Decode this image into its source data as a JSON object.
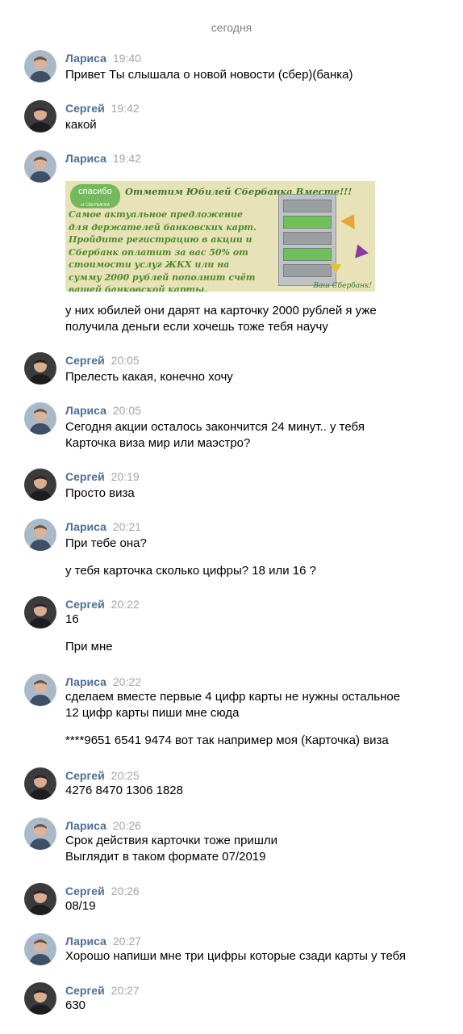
{
  "date_separator": "сегодня",
  "messages": [
    {
      "author": "Лариса",
      "time": "19:40",
      "lines": [
        "Привет Ты слышала о новой новости (сбер)(банка)"
      ]
    },
    {
      "author": "Сергей",
      "time": "19:42",
      "lines": [
        "какой"
      ]
    },
    {
      "author": "Лариса",
      "time": "19:42",
      "image": {
        "logo": "спасибо",
        "logo_sub": "от СБЕРБАНКА",
        "headline": "Отметим Юбилей Сбербанка Вместе!!!",
        "body": [
          "Самое актуальное предложение",
          "для держателей банковских карт.",
          "Пройдите регистрацию в акции и",
          "Сбербанк оплатит за вас 50% от",
          "стоимости услуг ЖКХ или на",
          "сумму 2000 рублей пополнит счёт",
          "вашей банковской карты."
        ],
        "signature": "Ваш Сбербанк!"
      },
      "lines": [
        "у них юбилей они дарят на карточку 2000 рублей я уже",
        "получила деньги если хочешь тоже тебя научу"
      ]
    },
    {
      "author": "Сергей",
      "time": "20:05",
      "lines": [
        "Прелесть какая, конечно хочу"
      ]
    },
    {
      "author": "Лариса",
      "time": "20:05",
      "lines": [
        "Сегодня акции осталось закончится 24 минут.. у тебя",
        "Карточка виза мир или маэстро?"
      ]
    },
    {
      "author": "Сергей",
      "time": "20:19",
      "lines": [
        "Просто виза"
      ]
    },
    {
      "author": "Лариса",
      "time": "20:21",
      "lines": [
        "При тебе она?",
        "у тебя карточка сколько цифры? 18 или 16 ?"
      ]
    },
    {
      "author": "Сергей",
      "time": "20:22",
      "lines": [
        "16",
        "При мне"
      ]
    },
    {
      "author": "Лариса",
      "time": "20:22",
      "lines": [
        "сделаем вместе первые 4 цифр карты не нужны остальное",
        "12 цифр карты пиши мне сюда",
        "****9651 6541 9474 вот так например моя (Карточка) виза"
      ]
    },
    {
      "author": "Сергей",
      "time": "20:25",
      "lines": [
        "4276 8470 1306 1828"
      ]
    },
    {
      "author": "Лариса",
      "time": "20:26",
      "lines": [
        "Срок действия карточки тоже пришли",
        "Выглядит в таком формате 07/2019"
      ]
    },
    {
      "author": "Сергей",
      "time": "20:26",
      "lines": [
        "08/19"
      ]
    },
    {
      "author": "Лариса",
      "time": "20:27",
      "lines": [
        "Хорошо напиши мне три цифры которые сзади карты у тебя"
      ]
    },
    {
      "author": "Сергей",
      "time": "20:27",
      "lines": [
        "630"
      ]
    }
  ],
  "colors": {
    "author": "#4d6d94",
    "time": "#a0a5ab",
    "separator": "#828282"
  }
}
